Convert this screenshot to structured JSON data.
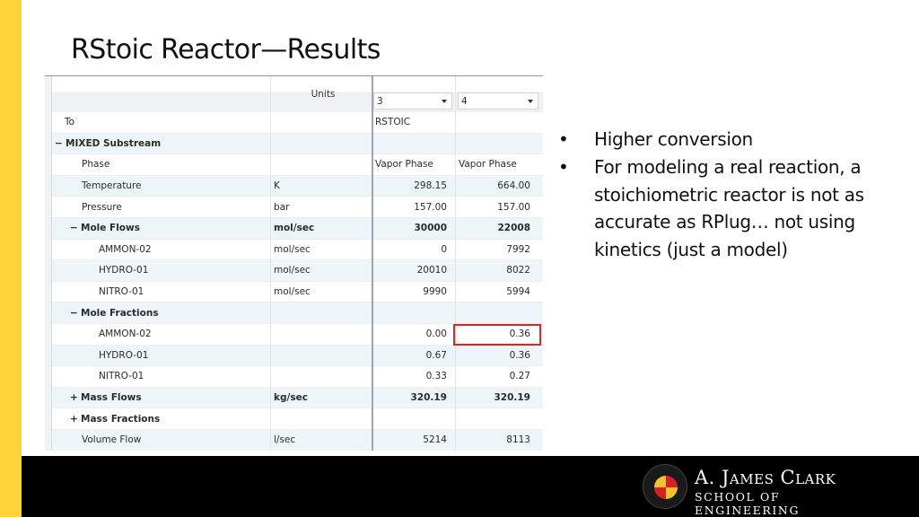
{
  "slide": {
    "title": "RStoic Reactor—Results",
    "accent_color": "#FFD43B",
    "footer_color": "#000000"
  },
  "table": {
    "units_header": "Units",
    "streams": [
      {
        "selected": "3"
      },
      {
        "selected": "4"
      }
    ],
    "rows": [
      {
        "label": "To",
        "toggle": "",
        "level": 0,
        "bold": false,
        "units": "",
        "v3": "RSTOIC",
        "v4": "",
        "text": true
      },
      {
        "label": "MIXED Substream",
        "toggle": "−",
        "level": 0,
        "bold": true,
        "units": "",
        "v3": "",
        "v4": "",
        "text": false
      },
      {
        "label": "Phase",
        "toggle": "",
        "level": 1,
        "bold": false,
        "units": "",
        "v3": "Vapor Phase",
        "v4": "Vapor Phase",
        "text": true
      },
      {
        "label": "Temperature",
        "toggle": "",
        "level": 1,
        "bold": false,
        "units": "K",
        "v3": "298.15",
        "v4": "664.00",
        "text": false
      },
      {
        "label": "Pressure",
        "toggle": "",
        "level": 1,
        "bold": false,
        "units": "bar",
        "v3": "157.00",
        "v4": "157.00",
        "text": false
      },
      {
        "label": "Mole Flows",
        "toggle": "−",
        "level": 1,
        "bold": true,
        "units": "mol/sec",
        "v3": "30000",
        "v4": "22008",
        "text": false
      },
      {
        "label": "AMMON-02",
        "toggle": "",
        "level": 2,
        "bold": false,
        "units": "mol/sec",
        "v3": "0",
        "v4": "7992",
        "text": false
      },
      {
        "label": "HYDRO-01",
        "toggle": "",
        "level": 2,
        "bold": false,
        "units": "mol/sec",
        "v3": "20010",
        "v4": "8022",
        "text": false
      },
      {
        "label": "NITRO-01",
        "toggle": "",
        "level": 2,
        "bold": false,
        "units": "mol/sec",
        "v3": "9990",
        "v4": "5994",
        "text": false
      },
      {
        "label": "Mole Fractions",
        "toggle": "−",
        "level": 1,
        "bold": true,
        "units": "",
        "v3": "",
        "v4": "",
        "text": false
      },
      {
        "label": "AMMON-02",
        "toggle": "",
        "level": 2,
        "bold": false,
        "units": "",
        "v3": "0.00",
        "v4": "0.36",
        "text": false,
        "highlight_v4": true
      },
      {
        "label": "HYDRO-01",
        "toggle": "",
        "level": 2,
        "bold": false,
        "units": "",
        "v3": "0.67",
        "v4": "0.36",
        "text": false
      },
      {
        "label": "NITRO-01",
        "toggle": "",
        "level": 2,
        "bold": false,
        "units": "",
        "v3": "0.33",
        "v4": "0.27",
        "text": false
      },
      {
        "label": "Mass Flows",
        "toggle": "+",
        "level": 1,
        "bold": true,
        "units": "kg/sec",
        "v3": "320.19",
        "v4": "320.19",
        "text": false
      },
      {
        "label": "Mass Fractions",
        "toggle": "+",
        "level": 1,
        "bold": true,
        "units": "",
        "v3": "",
        "v4": "",
        "text": false
      },
      {
        "label": "Volume Flow",
        "toggle": "",
        "level": 1,
        "bold": false,
        "units": "l/sec",
        "v3": "5214",
        "v4": "8113",
        "text": false
      }
    ],
    "highlight_color": "#e02424"
  },
  "bullets": [
    {
      "marker": "•",
      "text": "Higher conversion"
    },
    {
      "marker": "•",
      "text": "For modeling a real reaction, a stoichiometric reactor is not as accurate as RPlug… not using kinetics (just a model)"
    }
  ],
  "logo": {
    "name": "A. James Clark",
    "school": "SCHOOL OF ENGINEERING",
    "seal": "university-of-maryland-seal"
  }
}
